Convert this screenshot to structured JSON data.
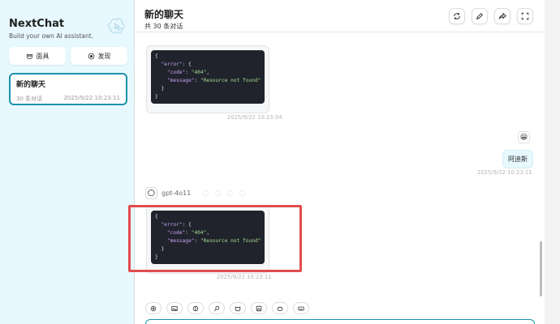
{
  "sidebar": {
    "brand_title": "NextChat",
    "brand_subtitle": "Build your own AI assistant.",
    "logo_icon": "openai-logo-icon",
    "buttons": [
      {
        "label": "面具",
        "icon": "mask-icon"
      },
      {
        "label": "发现",
        "icon": "discover-icon"
      }
    ],
    "session": {
      "title": "新的聊天",
      "count": "30 条对话",
      "time": "2025/9/22 10:23:11"
    }
  },
  "header": {
    "title": "新的聊天",
    "subtitle": "共 30 条对话",
    "actions": [
      "refresh-icon",
      "edit-icon",
      "share-icon",
      "fullscreen-icon"
    ]
  },
  "messages": {
    "first_timestamp": "2025/9/22 10:23:04",
    "user_emoji": "😀",
    "user_text": "阿迪斯",
    "user_timestamp": "2025/9/22 10:23:11",
    "bot_model": "gpt-4o11",
    "bot_timestamp": "2025/9/22 10:23:11",
    "code": {
      "line1": "{",
      "key_error": "\"error\"",
      "after_error": ": {",
      "key_code": "\"code\"",
      "val_code": "\"404\"",
      "key_message": "\"message\"",
      "val_message": "\"Resource not found\"",
      "close_inner": "}",
      "close_outer": "}"
    }
  },
  "toolbar_icons": [
    "settings-icon",
    "image-icon",
    "theme-icon",
    "prompt-icon",
    "mask-icon",
    "upload-image-icon",
    "robot-icon",
    "keyboard-icon"
  ],
  "colors": {
    "accent": "#1d93ab",
    "sidebar_bg": "#e7f8ff",
    "highlight": "#e24d4d",
    "code_bg": "#20232b"
  }
}
